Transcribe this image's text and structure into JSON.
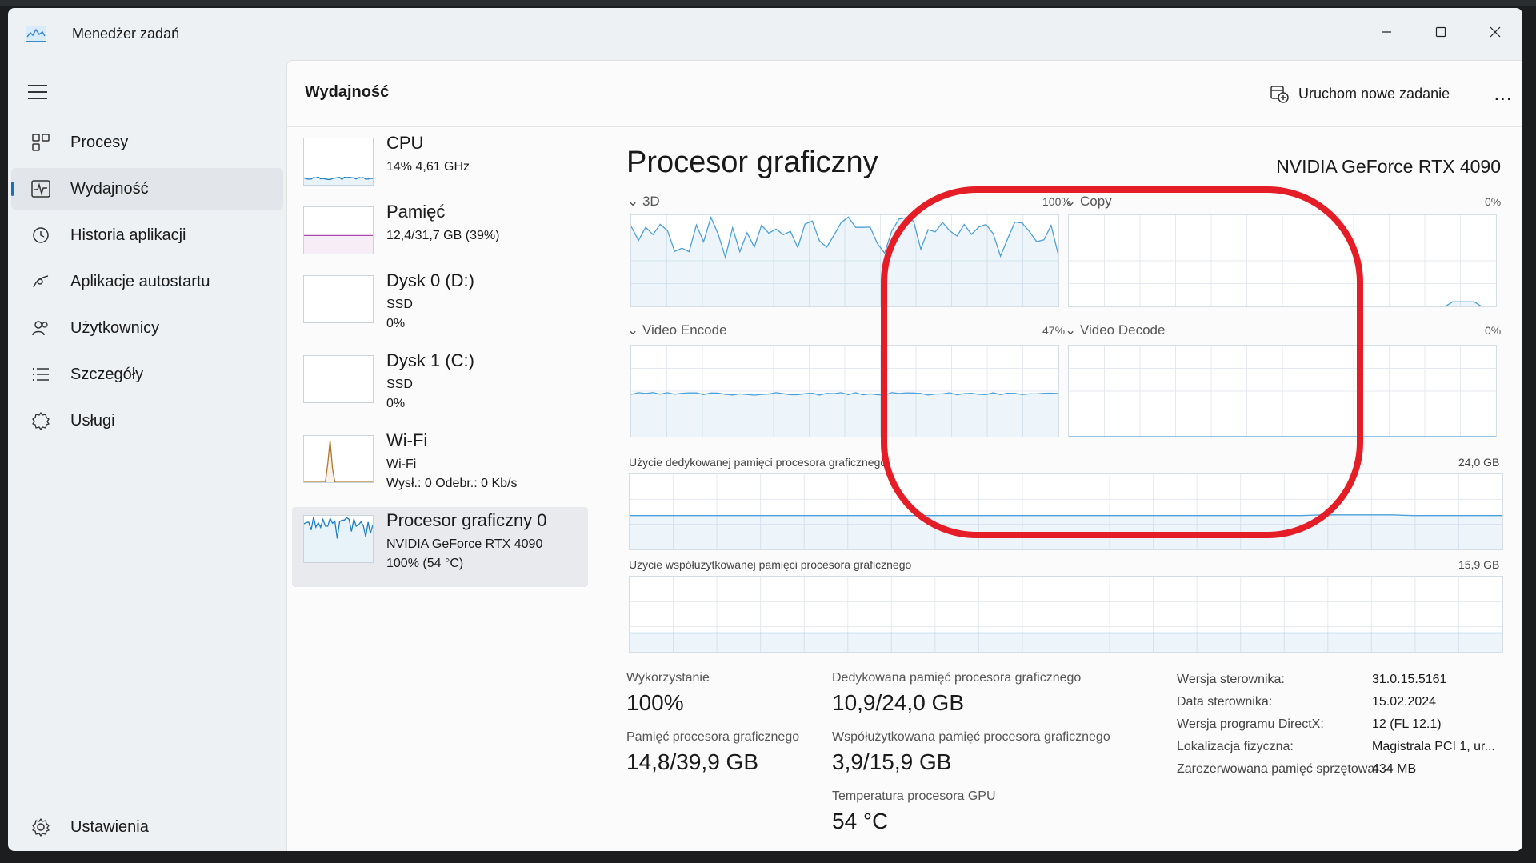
{
  "window": {
    "title": "Menedżer zadań"
  },
  "sidebar": {
    "items": [
      {
        "label": "Procesy",
        "icon": "processes-icon"
      },
      {
        "label": "Wydajność",
        "icon": "performance-icon"
      },
      {
        "label": "Historia aplikacji",
        "icon": "history-icon"
      },
      {
        "label": "Aplikacje autostartu",
        "icon": "startup-icon"
      },
      {
        "label": "Użytkownicy",
        "icon": "users-icon"
      },
      {
        "label": "Szczegóły",
        "icon": "details-icon"
      },
      {
        "label": "Usługi",
        "icon": "services-icon"
      }
    ],
    "active_index": 1,
    "settings_label": "Ustawienia"
  },
  "header": {
    "title": "Wydajność",
    "run_task_label": "Uruchom nowe zadanie",
    "more_label": "..."
  },
  "devices": [
    {
      "name": "CPU",
      "line2": "14%  4,61 GHz",
      "line3": "",
      "color": "#1b7ec9"
    },
    {
      "name": "Pamięć",
      "line2": "12,4/31,7 GB (39%)",
      "line3": "",
      "color": "#a94ab1"
    },
    {
      "name": "Dysk 0 (D:)",
      "line2": "SSD",
      "line3": "0%",
      "color": "#4a9a3a"
    },
    {
      "name": "Dysk 1 (C:)",
      "line2": "SSD",
      "line3": "0%",
      "color": "#4a9a3a"
    },
    {
      "name": "Wi-Fi",
      "line2": "Wi-Fi",
      "line3": "Wysł.: 0  Odebr.: 0 Kb/s",
      "color": "#b0762a"
    },
    {
      "name": "Procesor graficzny 0",
      "line2": "NVIDIA GeForce RTX 4090",
      "line3": "100%  (54 °C)",
      "color": "#1b7ec9"
    }
  ],
  "active_device": 5,
  "gpu": {
    "title": "Procesor graficzny",
    "model": "NVIDIA GeForce RTX 4090",
    "engines": [
      {
        "label": "3D",
        "percent": "100%",
        "level": 0.7
      },
      {
        "label": "Copy",
        "percent": "0%",
        "level": 0.01
      },
      {
        "label": "Video Encode",
        "percent": "47%",
        "level": 0.47
      },
      {
        "label": "Video Decode",
        "percent": "0%",
        "level": 0
      }
    ],
    "dedicated_mem_label": "Użycie dedykowanej pamięci procesora graficznego",
    "dedicated_mem_max": "24,0 GB",
    "dedicated_mem_level": 0.45,
    "shared_mem_label": "Użycie współużytkowanej pamięci procesora graficznego",
    "shared_mem_max": "15,9 GB",
    "shared_mem_level": 0.25,
    "stats": {
      "util_label": "Wykorzystanie",
      "util_value": "100%",
      "gpumem_label": "Pamięć procesora graficznego",
      "gpumem_value": "14,8/39,9 GB",
      "ded_label": "Dedykowana pamięć procesora graficznego",
      "ded_value": "10,9/24,0 GB",
      "shared_label": "Współużytkowana pamięć procesora graficznego",
      "shared_value": "3,9/15,9 GB",
      "temp_label": "Temperatura procesora GPU",
      "temp_value": "54 °C"
    },
    "info": [
      {
        "key": "Wersja sterownika:",
        "value": "31.0.15.5161"
      },
      {
        "key": "Data sterownika:",
        "value": "15.02.2024"
      },
      {
        "key": "Wersja programu DirectX:",
        "value": "12 (FL 12.1)"
      },
      {
        "key": "Lokalizacja fizyczna:",
        "value": "Magistrala PCI 1, ur..."
      },
      {
        "key": "Zarezerwowana pamięć sprzętowa:",
        "value": "434 MB"
      }
    ]
  },
  "colors": {
    "accent": "#1f6fb8",
    "graph_line": "#4aa0d8",
    "annotation": "#e51d26"
  }
}
